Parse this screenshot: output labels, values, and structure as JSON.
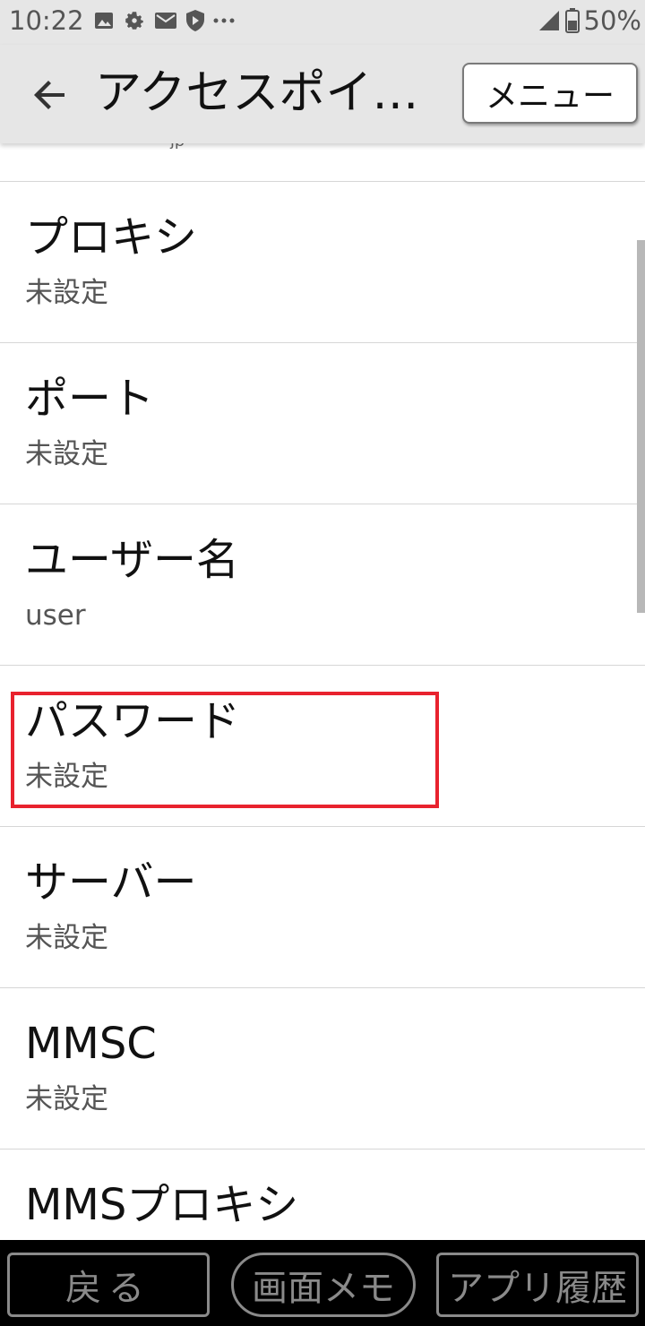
{
  "status_bar": {
    "time": "10:22",
    "battery": "50%",
    "icons": [
      "image-icon",
      "gear-icon",
      "mail-icon",
      "shield-icon",
      "more-dots-icon",
      "signal-icon",
      "battery-icon"
    ]
  },
  "app_bar": {
    "title": "アクセスポイ…",
    "menu_label": "メニュー"
  },
  "list": {
    "items": [
      {
        "title": "プロキシ",
        "summary": "未設定"
      },
      {
        "title": "ポート",
        "summary": "未設定"
      },
      {
        "title": "ユーザー名",
        "summary": "user"
      },
      {
        "title": "パスワード",
        "summary": "未設定"
      },
      {
        "title": "サーバー",
        "summary": "未設定"
      },
      {
        "title": "MMSC",
        "summary": "未設定"
      },
      {
        "title": "MMSプロキシ",
        "summary": ""
      }
    ]
  },
  "bottom_nav": {
    "back_label": "戻る",
    "memo_label": "画面メモ",
    "history_label": "アプリ履歴"
  },
  "colors": {
    "highlight": "#e8222e",
    "bar_background": "#e6e6e6"
  }
}
